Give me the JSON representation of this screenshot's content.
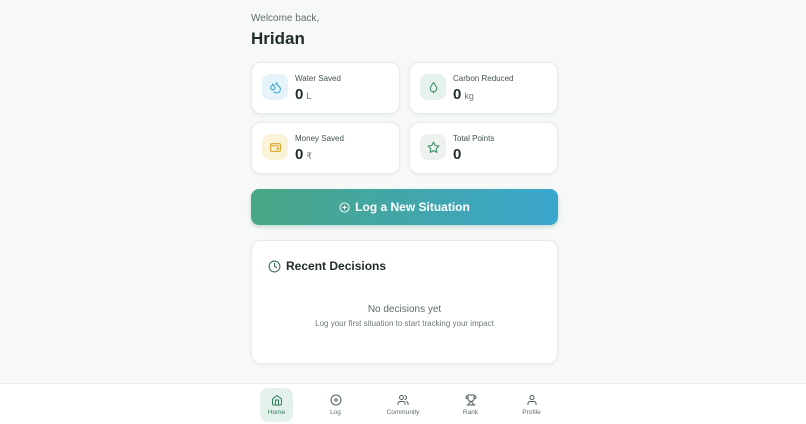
{
  "greeting": "Welcome back,",
  "username": "Hridan",
  "stats": [
    {
      "label": "Water Saved",
      "value": "0",
      "unit": "L",
      "icon": "droplets-icon",
      "color": "#3aa6cd"
    },
    {
      "label": "Carbon Reduced",
      "value": "0",
      "unit": "kg",
      "icon": "tree-icon",
      "color": "#3f8f6c"
    },
    {
      "label": "Money Saved",
      "value": "0",
      "unit": "₹",
      "icon": "wallet-icon",
      "color": "#d9a521"
    },
    {
      "label": "Total Points",
      "value": "0",
      "unit": "",
      "icon": "star-icon",
      "color": "#3f8f6c"
    }
  ],
  "log_button": {
    "label": "Log a New Situation",
    "icon": "plus-circle-icon"
  },
  "recent": {
    "title": "Recent Decisions",
    "icon": "clock-icon",
    "empty_title": "No decisions yet",
    "empty_subtitle": "Log your first situation to start tracking your impact"
  },
  "nav": [
    {
      "label": "Home",
      "icon": "home-icon",
      "active": true
    },
    {
      "label": "Log",
      "icon": "plus-circle-icon",
      "active": false
    },
    {
      "label": "Community",
      "icon": "users-icon",
      "active": false
    },
    {
      "label": "Rank",
      "icon": "trophy-icon",
      "active": false
    },
    {
      "label": "Profile",
      "icon": "user-icon",
      "active": false
    }
  ],
  "colors": {
    "accent": "#4aa785",
    "gradient_end": "#3aa6cd",
    "background": "#f7f9f8"
  }
}
